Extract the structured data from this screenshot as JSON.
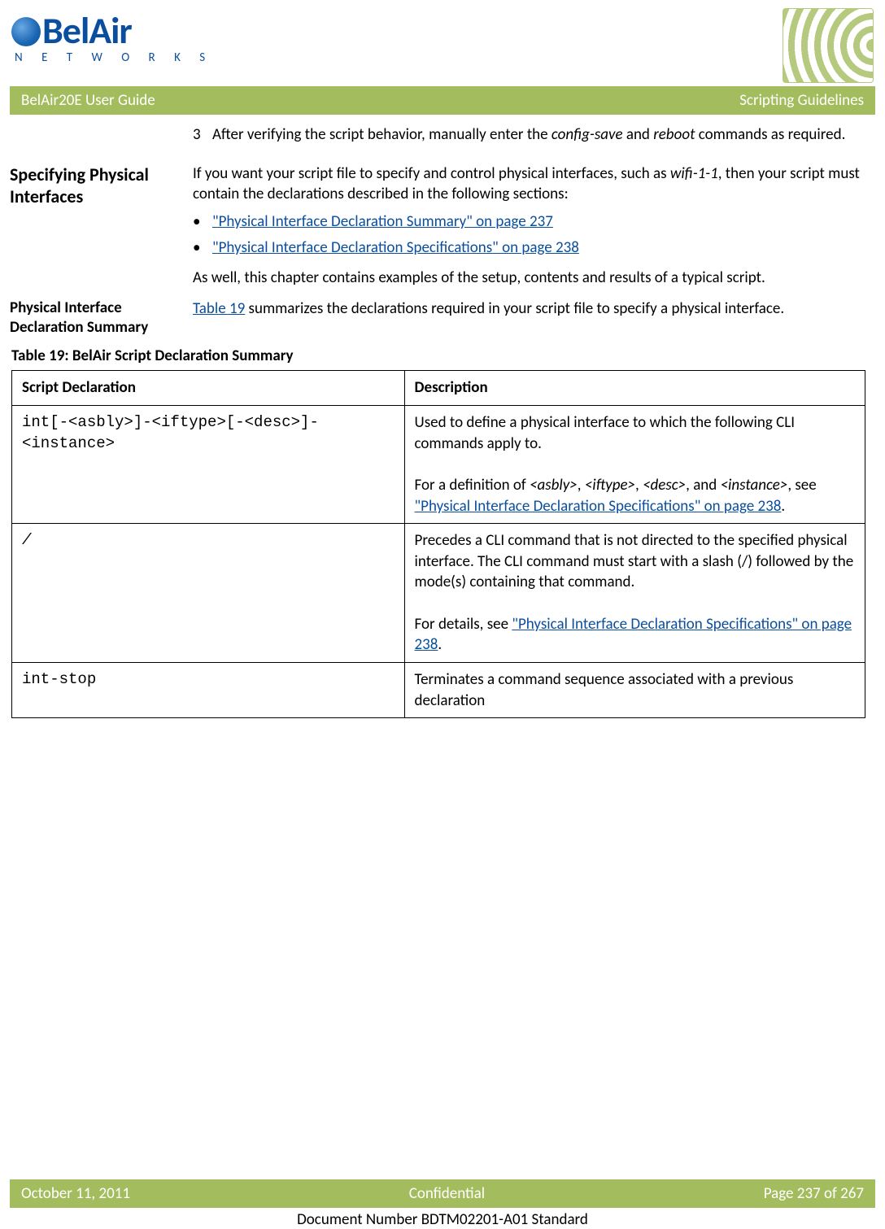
{
  "logo": {
    "name": "BelAir",
    "sub": "N E T W O R K S"
  },
  "topbar": {
    "left": "BelAir20E User Guide",
    "right": "Scripting Guidelines"
  },
  "step3": {
    "num": "3",
    "text_a": "After verifying the script behavior, manually enter the ",
    "cmd1": "config-save",
    "text_b": " and ",
    "cmd2": "reboot",
    "text_c": " commands as required."
  },
  "sec1": {
    "heading": "Specifying Physical Interfaces",
    "p1a": "If you want your script file to specify and control physical interfaces, such as ",
    "p1i": "wifi-1-1",
    "p1b": ", then your script must contain the declarations described in the following sections:",
    "b1": "\"Physical Interface Declaration Summary\" on page 237",
    "b2": "\"Physical Interface Declaration Specifications\" on page 238",
    "p2": "As well, this chapter contains examples of the setup, contents and results of a typical script."
  },
  "sec2": {
    "heading": "Physical Interface Declaration Summary",
    "link": "Table 19",
    "rest": " summarizes the declarations required in your script file to specify a physical interface."
  },
  "table": {
    "caption": "Table 19: BelAir Script Declaration Summary",
    "h1": "Script Declaration",
    "h2": "Description",
    "r1c1": "int[-<asbly>]-<iftype>[-<desc>]-<instance>",
    "r1c2_p1": "Used to define a physical interface to which the following CLI commands apply to.",
    "r1c2_p2a": "For a definition of ",
    "r1c2_i1": "<asbly>",
    "r1c2_s1": ", ",
    "r1c2_i2": "<iftype>",
    "r1c2_s2": ", ",
    "r1c2_i3": "<desc>",
    "r1c2_s3": ", and ",
    "r1c2_i4": "<instance>",
    "r1c2_s4": ", see ",
    "r1c2_link": "\"Physical Interface Declaration Specifications\" on page 238",
    "r1c2_s5": ".",
    "r2c1": "/",
    "r2c2_p1": "Precedes a CLI command that is not directed to the specified physical interface. The CLI command must start with a slash (/) followed by the mode(s) containing that command.",
    "r2c2_p2a": "For details, see ",
    "r2c2_link": "\"Physical Interface Declaration Specifications\" on page 238",
    "r2c2_p2b": ".",
    "r3c1": "int-stop",
    "r3c2": "Terminates a command sequence associated with a previous declaration"
  },
  "footer": {
    "date": "October 11, 2011",
    "center": "Confidential",
    "page": "Page 237 of 267",
    "docnum": "Document Number BDTM02201-A01 Standard"
  }
}
